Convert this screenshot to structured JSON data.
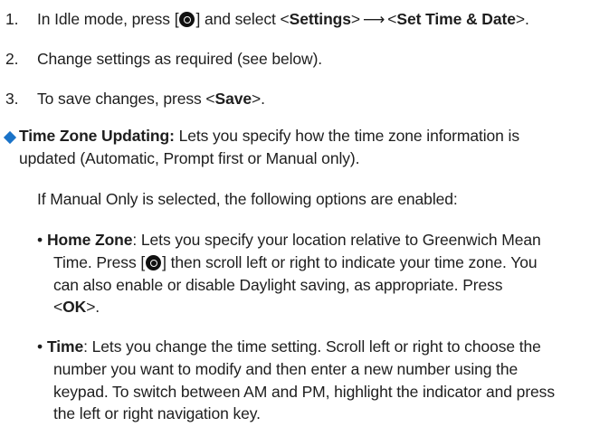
{
  "steps": [
    {
      "number": "1.",
      "pre": "In Idle mode, press [",
      "post": "] and select <",
      "b1": "Settings",
      "mid": ">",
      "b1b": "<",
      "b2": "Set Time & Date",
      "end": ">."
    },
    {
      "number": "2.",
      "text": "Change settings as required (see below)."
    },
    {
      "number": "3.",
      "pre": "To save changes, press <",
      "bold": "Save",
      "post": ">."
    }
  ],
  "arrow_glyph": "⟶",
  "option": {
    "title": "Time Zone Updating:",
    "line1": " Lets you specify how the time zone information is",
    "line2": "updated (Automatic, Prompt first or Manual only).",
    "manual_note": "If Manual Only is selected, the following options are enabled:"
  },
  "sub_options": [
    {
      "bullet": "•",
      "title": "Home Zone",
      "line1": ": Lets you specify your location relative to Greenwich Mean",
      "line2_pre": "Time. Press [",
      "line2_post": "] then scroll left or right to indicate your time zone. You",
      "line3": "can also enable or disable Daylight saving, as appropriate. Press",
      "line4_pre": "<",
      "line4_bold": "OK",
      "line4_post": ">."
    },
    {
      "bullet": "•",
      "title": "Time",
      "line1": ": Lets you change the time setting. Scroll left or right to choose the",
      "line2": "number you want to modify and then enter a new number using the",
      "line3": "keypad. To switch between AM and PM, highlight the indicator and press",
      "line4": "the left or right navigation key."
    }
  ],
  "colors": {
    "text": "#1e1e1e",
    "diamond": "#1a73c8"
  },
  "icons": {
    "nav_key": "circle-nav-key-icon"
  }
}
